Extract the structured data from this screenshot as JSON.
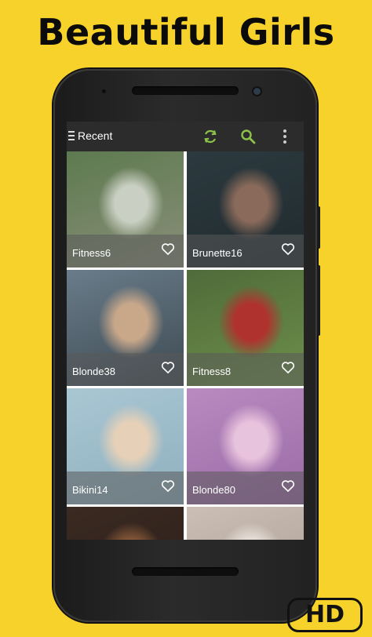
{
  "promo": {
    "headline": "Beautiful Girls",
    "badge": "HD"
  },
  "app": {
    "toolbar": {
      "title": "Recent",
      "icons": [
        "menu-icon",
        "refresh-icon",
        "search-icon",
        "overflow-menu-icon"
      ],
      "accent": "#8bc34a"
    },
    "items": [
      {
        "label": "Fitness6",
        "palette": [
          "#5d7a4f",
          "#c9cfc2",
          "#8a8f7a"
        ]
      },
      {
        "label": "Brunette16",
        "palette": [
          "#2c3a3f",
          "#8a6a5a",
          "#1f2a2e"
        ]
      },
      {
        "label": "Blonde38",
        "palette": [
          "#6a7c8a",
          "#c9a88a",
          "#3d4a52"
        ]
      },
      {
        "label": "Fitness8",
        "palette": [
          "#4f6b3a",
          "#b0322f",
          "#6d8f4a"
        ]
      },
      {
        "label": "Bikini14",
        "palette": [
          "#a9c6d3",
          "#e6d1b8",
          "#8fb0bf"
        ]
      },
      {
        "label": "Blonde80",
        "palette": [
          "#b98ac0",
          "#e8c3dd",
          "#9a6aa6"
        ]
      },
      {
        "label": "",
        "palette": [
          "#3a2a22",
          "#8a5a3a",
          "#2a1d17"
        ]
      },
      {
        "label": "",
        "palette": [
          "#cbbfb6",
          "#e9e2dc",
          "#a89a8e"
        ]
      }
    ]
  }
}
